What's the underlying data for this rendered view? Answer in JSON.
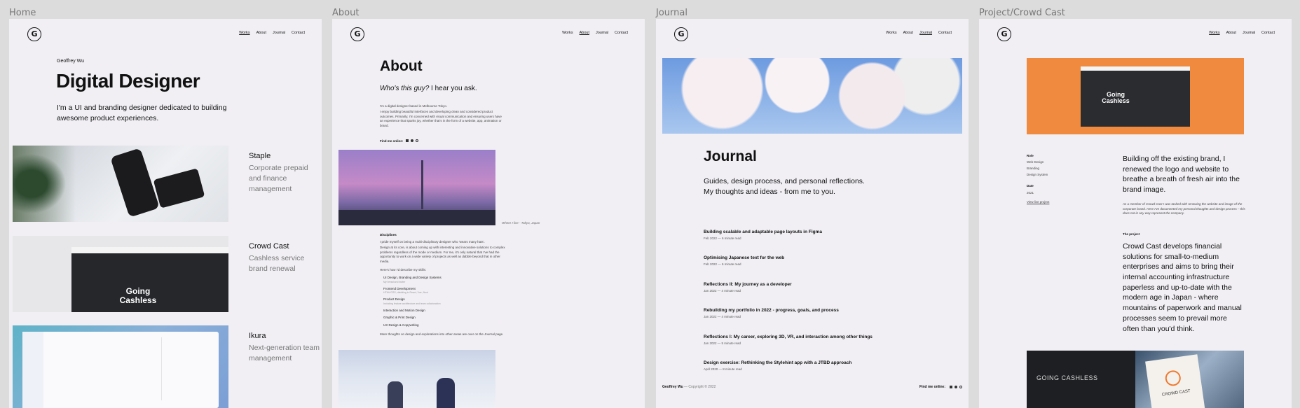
{
  "frames": {
    "home_label": "Home",
    "about_label": "About",
    "journal_label": "Journal",
    "project_label": "Project/Crowd Cast"
  },
  "nav": {
    "works": "Works",
    "about": "About",
    "journal": "Journal",
    "contact": "Contact"
  },
  "logo_letter": "G",
  "home": {
    "name": "Geoffrey Wu",
    "title": "Digital Designer",
    "intro": "I'm a UI and branding designer dedicated to building awesome product experiences.",
    "projects": [
      {
        "name": "Staple",
        "desc": "Corporate prepaid and finance management"
      },
      {
        "name": "Crowd Cast",
        "desc": "Cashless service brand renewal"
      },
      {
        "name": "Ikura",
        "desc": "Next-generation team management"
      }
    ],
    "going_cashless": "Going Cashless"
  },
  "about": {
    "title": "About",
    "question_em": "Who's this guy?",
    "question_rest": " I hear you ask.",
    "p1": "I'm a digital designer based in Melbourne Tokyo.",
    "p2": "I enjoy building beautiful interfaces and developing clean and considered product outcomes. Primarily, I'm concerned with visual communication and ensuring users have an experience that sparks joy, whether that's in the form of a website, app, animation or brand.",
    "find_me": "Find me online:",
    "caption": "Where I live - Tokyo, Japan",
    "disciplines_title": "Disciplines",
    "disciplines_p1": "I pride myself on being a multi-disciplinary designer who 'wears many hats'.",
    "disciplines_p2": "Design at its core, is about coming up with interesting and innovative solutions to complex problems regardless of the mode or medium. For me, it's only natural that I've had the opportunity to work on a wide variety of projects as well as dabble beyond that in other media.",
    "skills_intro": "Here's how I'd describe my skills:",
    "skills": [
      {
        "name": "UI Design, Branding and Design Systems",
        "sub": "My bread and butter"
      },
      {
        "name": "Frontend Development",
        "sub": "HTML/CSS, dabbling in React, Vue, Nuxt"
      },
      {
        "name": "Product Design",
        "sub": "Including feature architecture and team collaboration"
      },
      {
        "name": "Interaction and Motion Design",
        "sub": ""
      },
      {
        "name": "Graphic & Print Design",
        "sub": ""
      },
      {
        "name": "UX Design & Copywriting",
        "sub": ""
      }
    ],
    "more": "More thoughts on design and explorations into other areas are over on the Journal page."
  },
  "journal": {
    "title": "Journal",
    "subtitle": "Guides, design process, and personal reflections. My thoughts and ideas - from me to you.",
    "entries": [
      {
        "title": "Building scalable and adaptable page layouts in Figma",
        "meta": "Feb 2022 — 6 minute read"
      },
      {
        "title": "Optimising Japanese text for the web",
        "meta": "Feb 2022 — 6 minute read"
      },
      {
        "title": "Reflections II: My journey as a developer",
        "meta": "Jan 2022 — 4 minute read"
      },
      {
        "title": "Rebuilding my portfolio in 2022 - progress, goals, and process",
        "meta": "Jan 2022 — 4 minute read"
      },
      {
        "title": "Reflections I: My career, exploring 3D, VR, and interaction among other things",
        "meta": "Jan 2022 — 5 minute read"
      },
      {
        "title": "Design exercise: Rethinking the Stylehint app with a JTBD approach",
        "meta": "April 2020 — 8 minute read"
      }
    ],
    "footer_name": "Geoffrey Wu",
    "footer_copy": "— Copyright © 2022",
    "footer_find": "Find me online:"
  },
  "project": {
    "role_label": "Role",
    "roles": [
      "Web Design",
      "Branding",
      "Design System"
    ],
    "date_label": "Date",
    "date": "2021",
    "view_live": "View live project",
    "lead": "Building off the existing brand, I renewed the logo and website to breathe a breath of fresh air into the brand image.",
    "note": "As a member of Crowd Cast I was tasked with renewing the website and image of the corporate brand. Here I've documented my personal thoughts and design process – this does not in any way represent the company.",
    "project_label": "The project",
    "project_text": "Crowd Cast develops financial solutions for small-to-medium enterprises and aims to bring their internal accounting infrastructure paperless and up-to-date with the modern age in Japan - where mountains of paperwork and manual processes seem to prevail more often than you'd think.",
    "going_cashless": "Going Cashless",
    "dark_cashless": "GOING CASHLESS",
    "brand": "CROWD CAST"
  }
}
